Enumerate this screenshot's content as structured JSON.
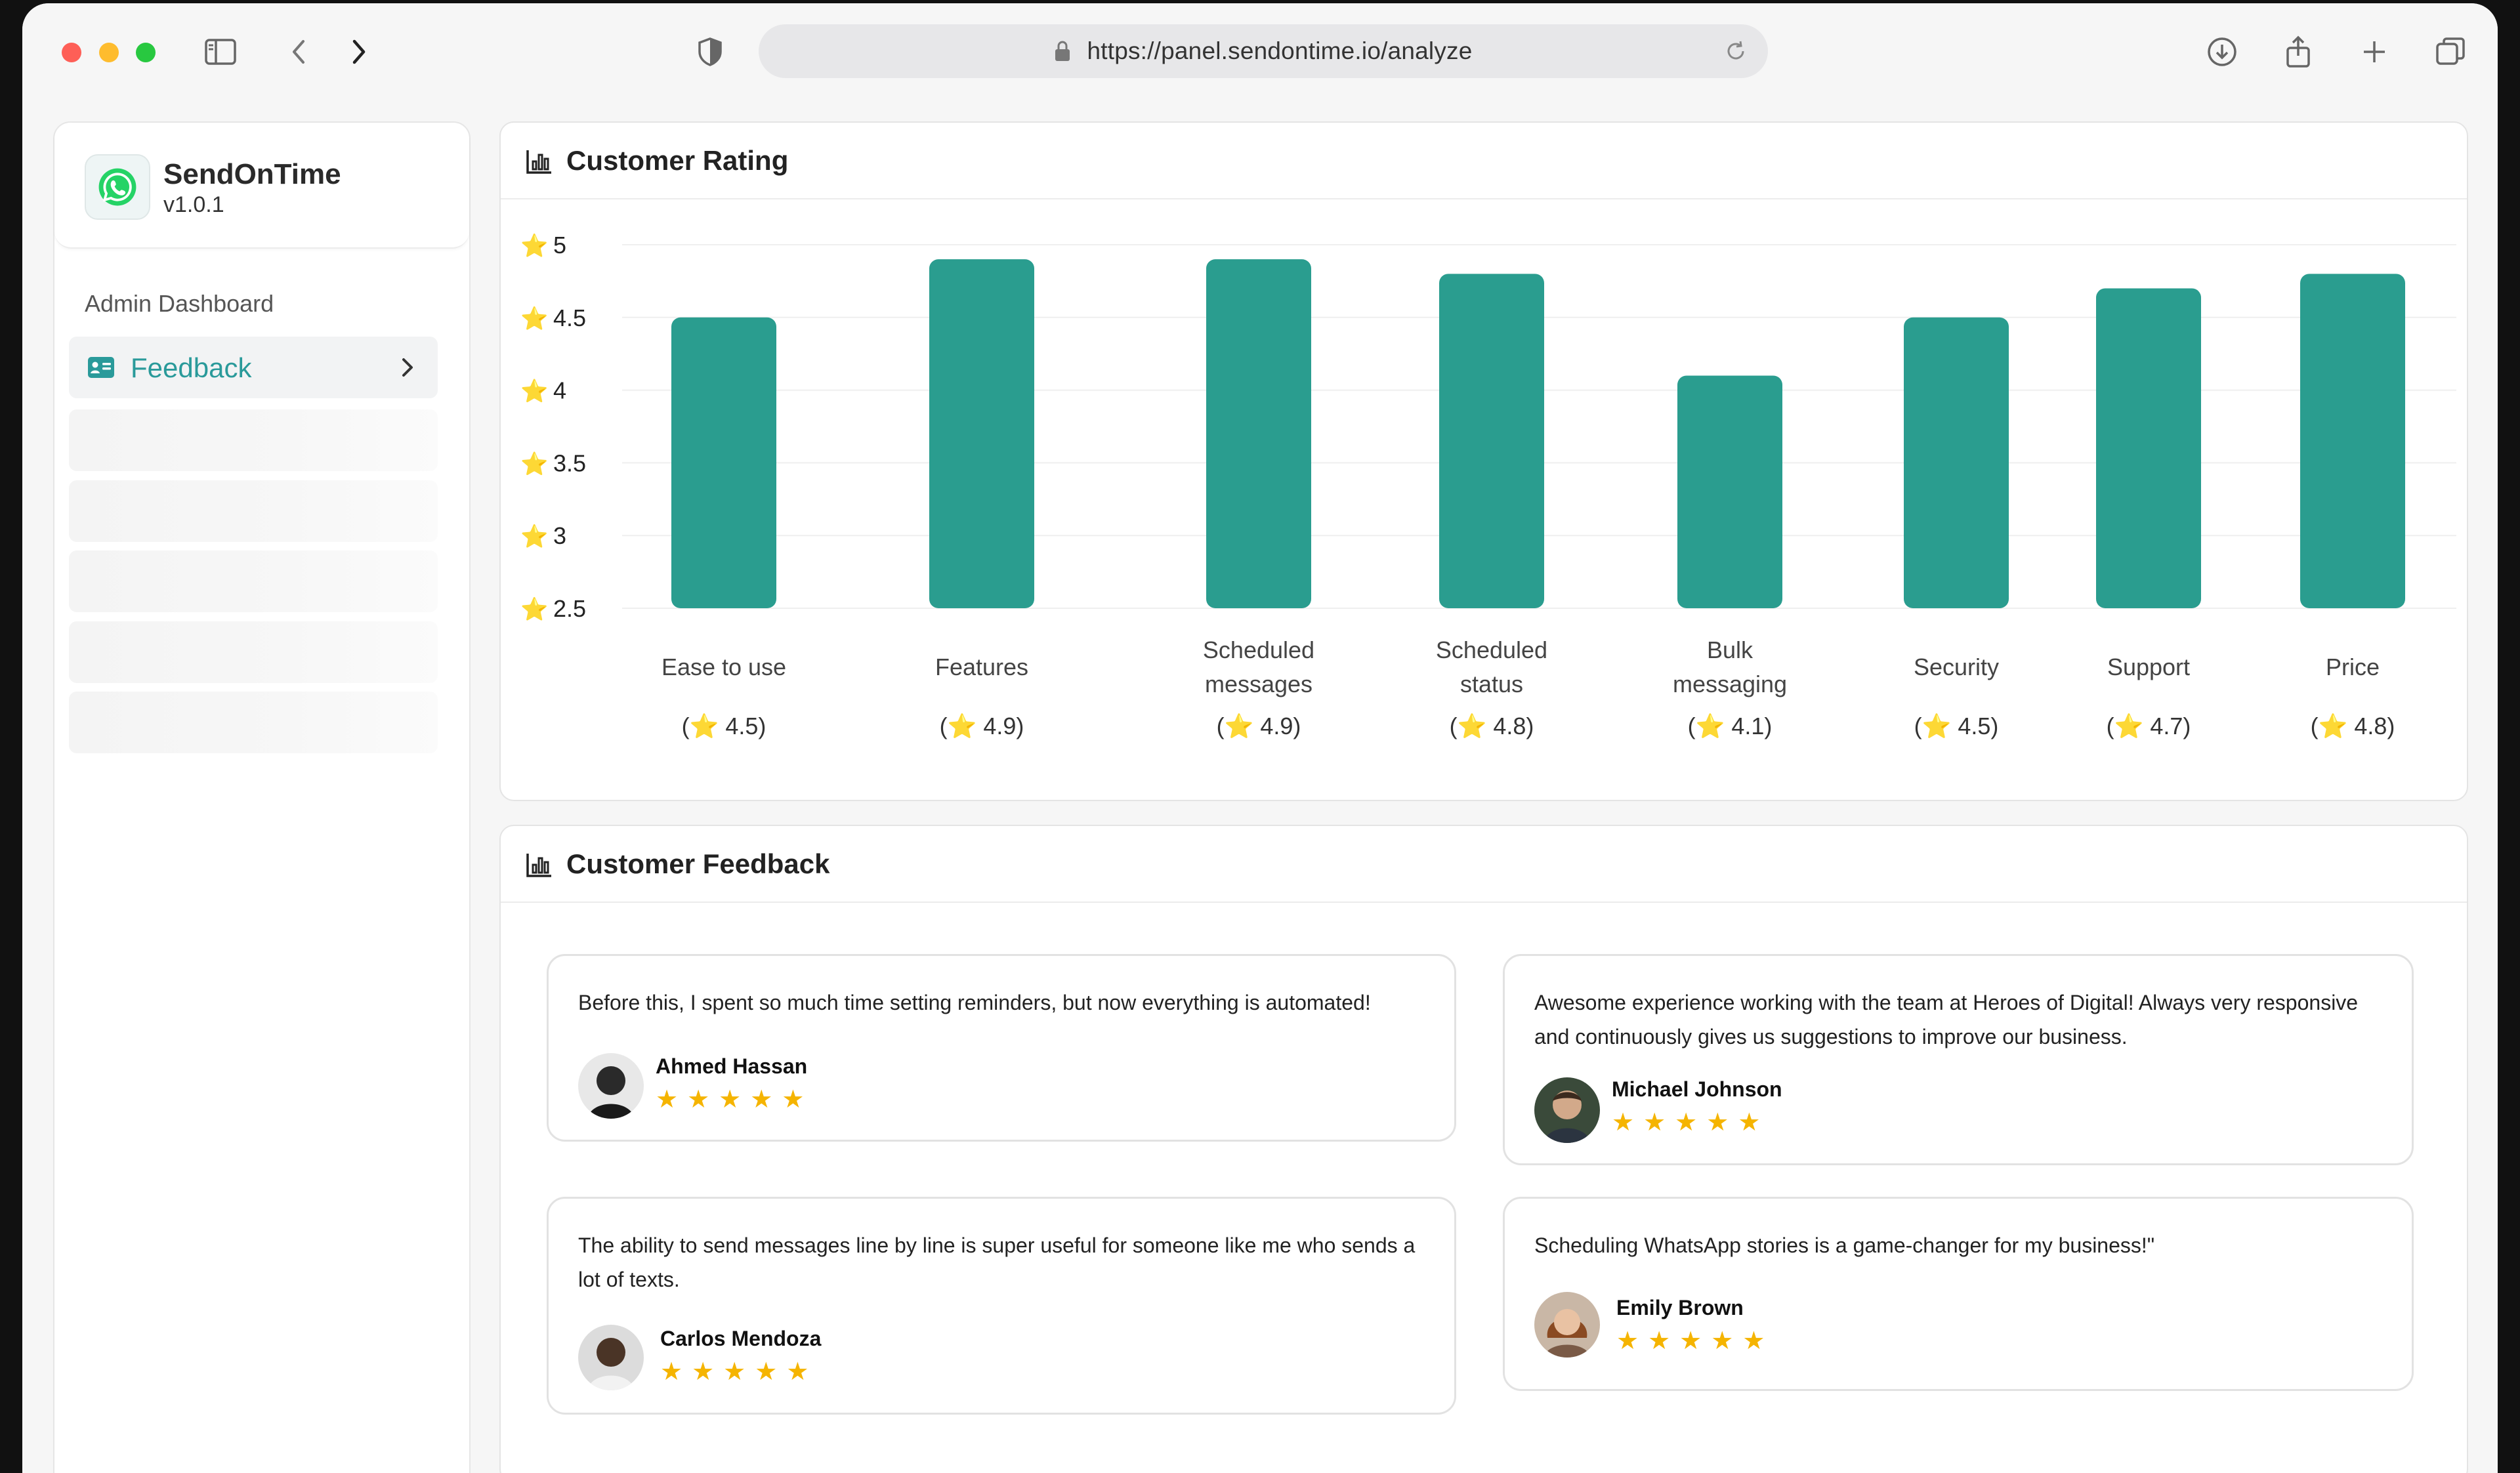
{
  "browser": {
    "url": "https://panel.sendontime.io/analyze"
  },
  "sidebar": {
    "brand_name": "SendOnTime",
    "brand_version": "v1.0.1",
    "section_label": "Admin Dashboard",
    "active_item": "Feedback"
  },
  "rating_panel": {
    "title": "Customer Rating"
  },
  "chart_data": {
    "type": "bar",
    "title": "Customer Rating",
    "categories": [
      "Ease to use",
      "Features",
      "Scheduled messages",
      "Scheduled status",
      "Bulk messaging",
      "Security",
      "Support",
      "Price"
    ],
    "values": [
      4.5,
      4.9,
      4.9,
      4.8,
      4.1,
      4.5,
      4.7,
      4.8
    ],
    "value_labels": [
      "(⭐ 4.5)",
      "(⭐ 4.9)",
      "(⭐ 4.9)",
      "(⭐ 4.8)",
      "(⭐ 4.1)",
      "(⭐ 4.5)",
      "(⭐ 4.7)",
      "(⭐ 4.8)"
    ],
    "yticks": [
      "5",
      "4.5",
      "4",
      "3.5",
      "3",
      "2.5"
    ],
    "ylim": [
      2.5,
      5
    ],
    "grid": true,
    "bar_color": "#2a9d8f"
  },
  "feedback_panel": {
    "title": "Customer Feedback",
    "cards": [
      {
        "quote": "Before this, I spent so much time setting reminders, but now everything is automated!",
        "name": "Ahmed Hassan",
        "rating": 5
      },
      {
        "quote": "Awesome experience working with the team at Heroes of Digital! Always very responsive and continuously gives us suggestions to improve our business.",
        "name": "Michael Johnson",
        "rating": 5
      },
      {
        "quote": "The ability to send messages line by line is super useful for someone like me who sends a lot of texts.",
        "name": "Carlos Mendoza",
        "rating": 5
      },
      {
        "quote": "Scheduling WhatsApp stories is a game-changer for my business!\"",
        "name": "Emily Brown",
        "rating": 5
      }
    ]
  },
  "colors": {
    "accent": "#2a9a9a",
    "bar": "#2a9d8f",
    "star": "#f5b400"
  }
}
